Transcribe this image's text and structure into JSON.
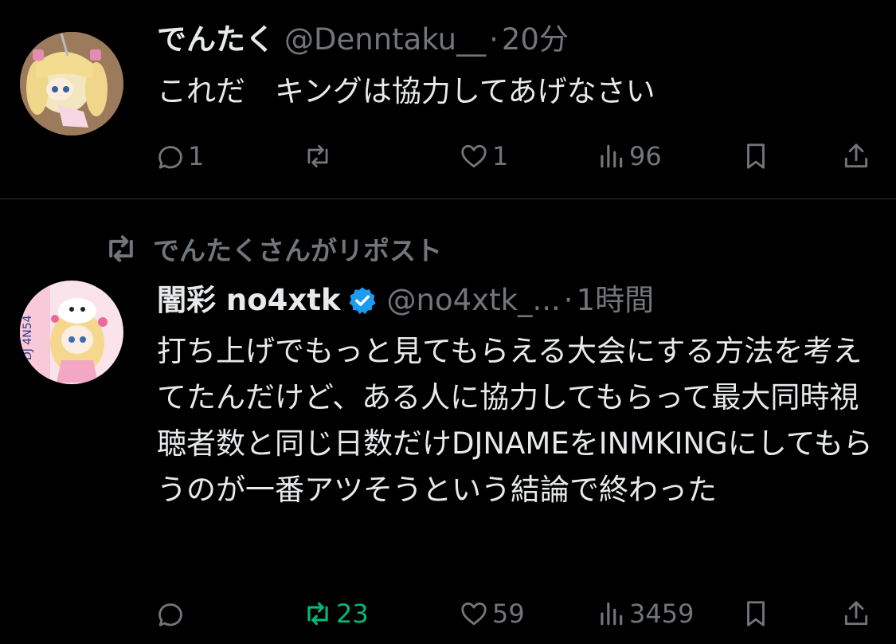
{
  "tweets": [
    {
      "display_name": "でんたく",
      "handle": "@Denntaku__",
      "time": "20分",
      "text": "これだ　キングは協力してあげなさい",
      "avatar": "avatar-anime-girl-keychain",
      "stats": {
        "replies": "1",
        "reposts": "",
        "likes": "1",
        "views": "96"
      }
    },
    {
      "repost_banner": "でんたくさんがリポスト",
      "display_name": "闇彩 no4xtk",
      "verified": true,
      "handle": "@no4xtk_...",
      "time": "1時間",
      "text": "打ち上げでもっと見てもらえる大会にする方法を考えてたんだけど、ある人に協力してもらって最大同時視聴者数と同じ日数だけDJNAMEをINMKINGにしてもらうのが一番アツそうという結論で終わった",
      "avatar": "avatar-anime-dj-girl",
      "stats": {
        "replies": "",
        "reposts": "23",
        "likes": "59",
        "views": "3459"
      },
      "reposted_by_me": true
    }
  ],
  "colors": {
    "background": "#000000",
    "text_primary": "#e7e9ea",
    "text_secondary": "#71767b",
    "repost_active": "#00ba7c",
    "verified_badge": "#1d9bf0",
    "divider": "#2f3336"
  },
  "icons": [
    "reply-icon",
    "repost-icon",
    "like-icon",
    "views-icon",
    "bookmark-icon",
    "share-icon",
    "verified-badge-icon"
  ]
}
